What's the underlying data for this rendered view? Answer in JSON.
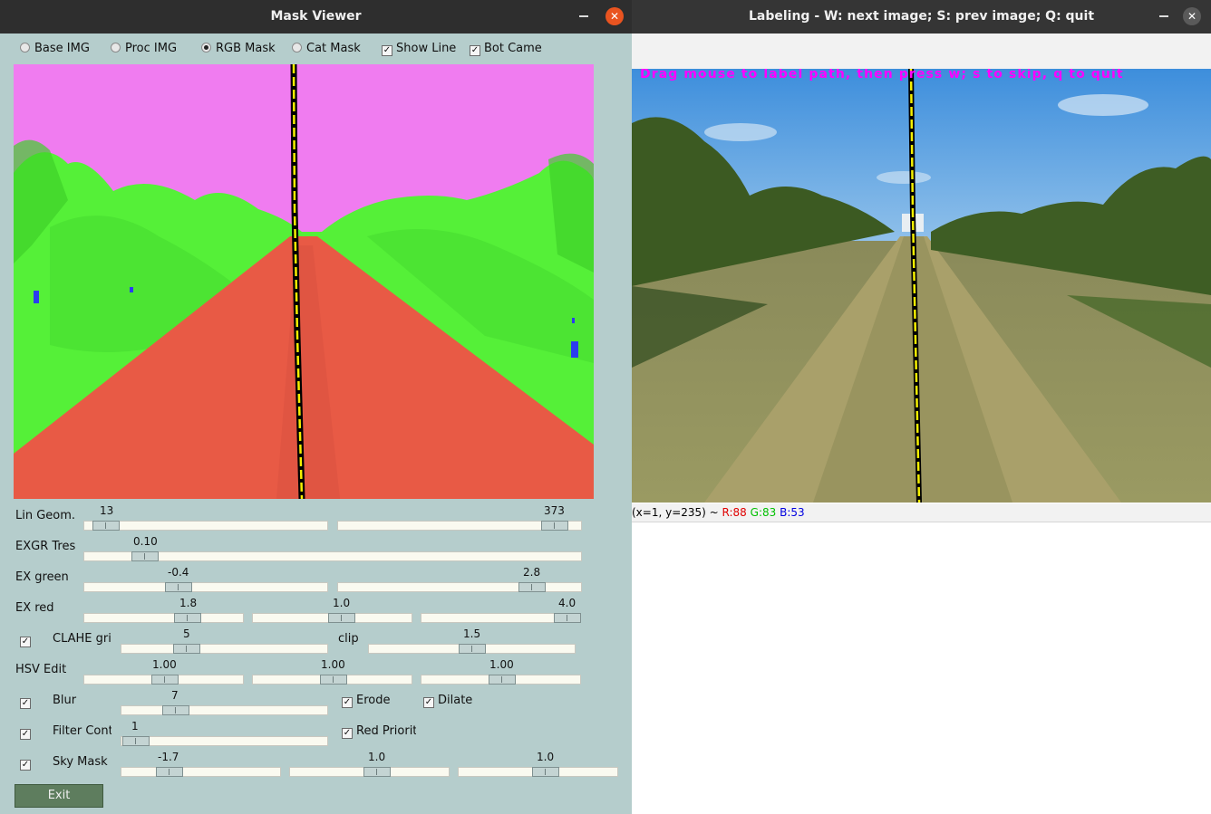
{
  "mask_viewer": {
    "title": "Mask Viewer",
    "radios": [
      {
        "label": "Base IMG",
        "checked": false
      },
      {
        "label": "Proc IMG",
        "checked": false
      },
      {
        "label": "RGB Mask",
        "checked": true
      },
      {
        "label": "Cat Mask",
        "checked": false
      }
    ],
    "top_checks": [
      {
        "label": "Show Line",
        "checked": true
      },
      {
        "label": "Bot Camera",
        "checked": true
      }
    ],
    "rows": {
      "lin_geom": {
        "label": "Lin Geom.",
        "values": [
          "13",
          "373"
        ]
      },
      "exgr": {
        "label": "EXGR Treshold",
        "values": [
          "0.10"
        ]
      },
      "ex_green": {
        "label": "EX green",
        "values": [
          "-0.4",
          "2.8"
        ]
      },
      "ex_red": {
        "label": "EX red",
        "values": [
          "1.8",
          "1.0",
          "4.0"
        ]
      },
      "clahe": {
        "label": "CLAHE grid",
        "checked": true,
        "values": [
          "5",
          "1.5"
        ],
        "clip_label": "clip"
      },
      "hsv": {
        "label": "HSV Edit",
        "values": [
          "1.00",
          "1.00",
          "1.00"
        ]
      },
      "blur": {
        "label": "Blur",
        "checked": true,
        "values": [
          "7"
        ],
        "erode_label": "Erode",
        "erode_checked": true,
        "dilate_label": "Dilate",
        "dilate_checked": true
      },
      "filter": {
        "label": "Filter Contours",
        "checked": true,
        "values": [
          "1"
        ],
        "red_label": "Red Priority",
        "red_checked": true
      },
      "sky": {
        "label": "Sky Mask",
        "checked": true,
        "values": [
          "-1.7",
          "1.0",
          "1.0"
        ]
      }
    },
    "exit_label": "Exit",
    "mask_colors": {
      "sky": "#f07cf0",
      "vegetation": "#55f038",
      "path": "#e85a45",
      "obstacle": "#2b3cf0",
      "line": "#f5f000"
    }
  },
  "labeling": {
    "title": "Labeling - W: next image; S: prev image; Q: quit",
    "overlay_text": "Drag mouse to label path, then press w; s to skip, q to quit",
    "status": {
      "coords": "(x=1, y=235) ~ ",
      "r": "R:88",
      "g": "G:83",
      "b": "B:53",
      "r_color": "#e00000",
      "g_color": "#00c000",
      "b_color": "#0000e0"
    }
  }
}
